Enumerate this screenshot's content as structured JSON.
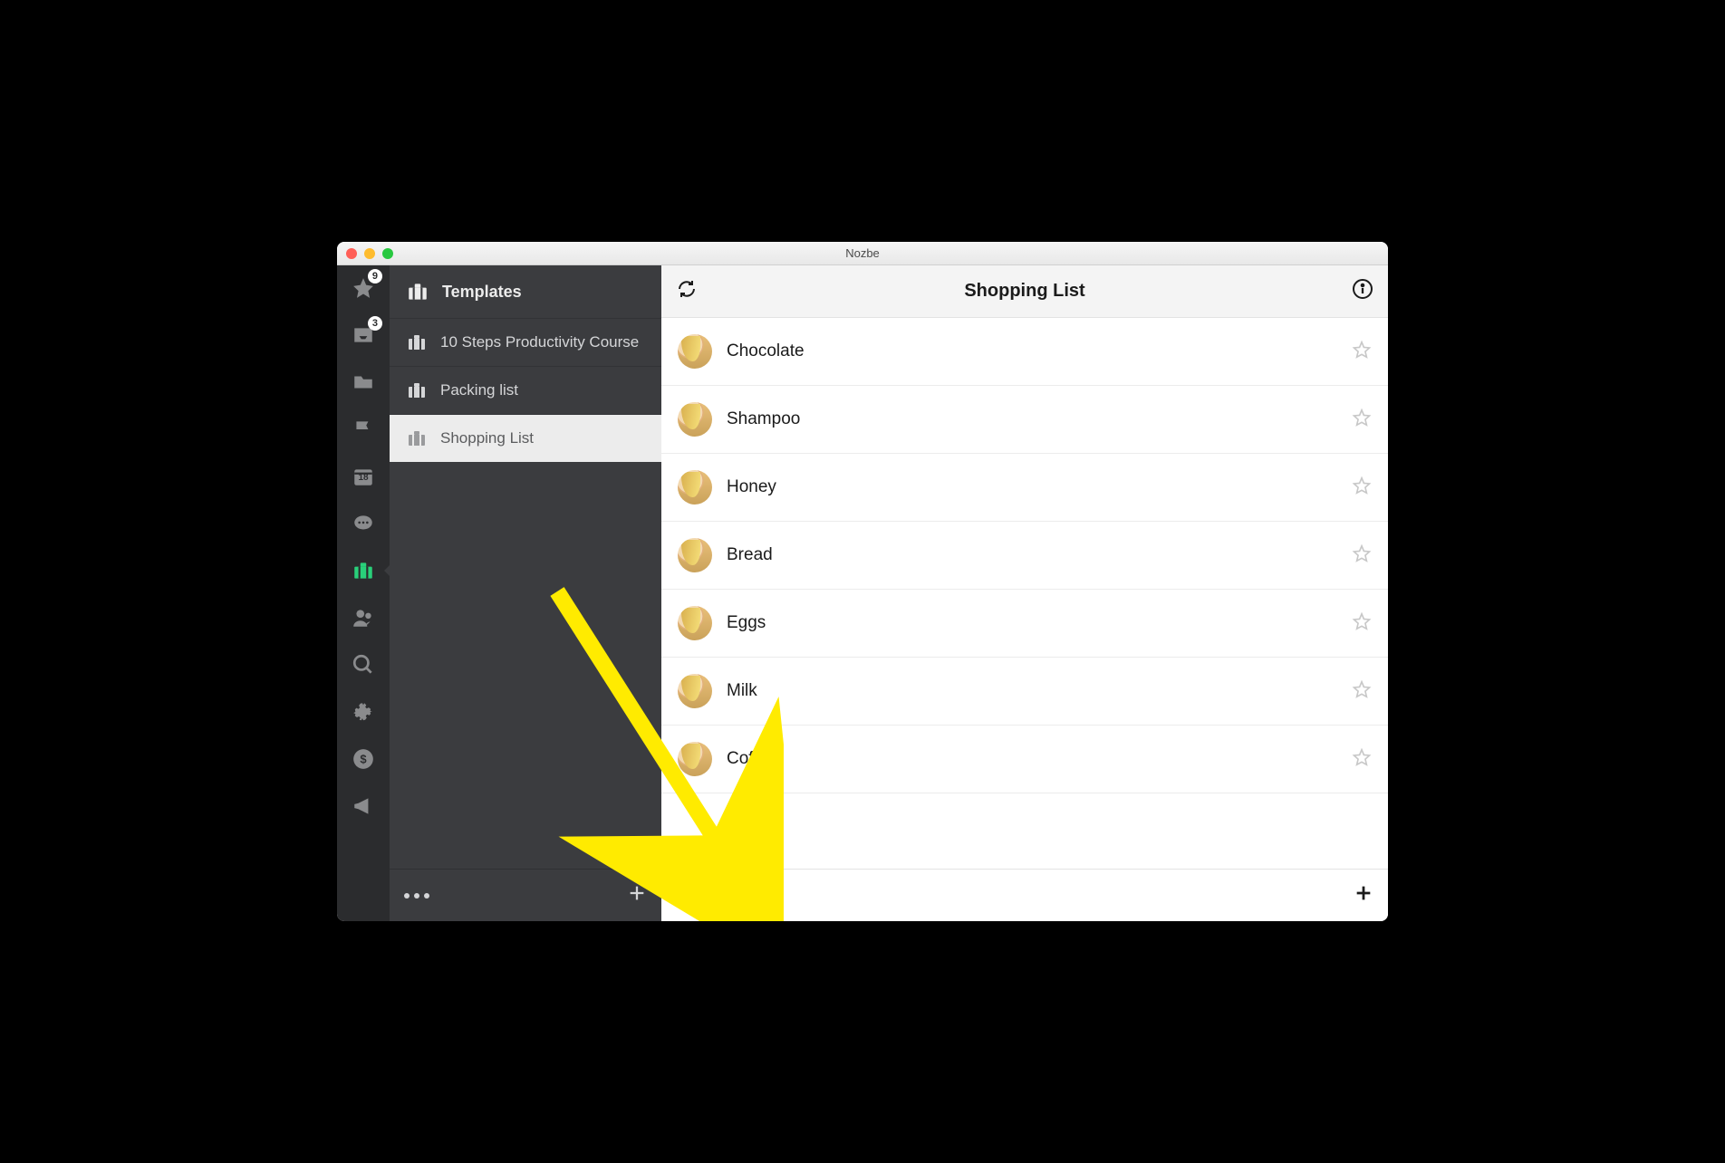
{
  "window": {
    "title": "Nozbe"
  },
  "rail": {
    "items": [
      {
        "id": "priority",
        "badge": "9"
      },
      {
        "id": "inbox",
        "badge": "3"
      },
      {
        "id": "projects"
      },
      {
        "id": "flag"
      },
      {
        "id": "calendar",
        "number": "18"
      },
      {
        "id": "comments"
      },
      {
        "id": "templates",
        "active": true
      },
      {
        "id": "team"
      },
      {
        "id": "search"
      },
      {
        "id": "settings"
      },
      {
        "id": "account"
      },
      {
        "id": "announce"
      }
    ]
  },
  "templates": {
    "header": "Templates",
    "items": [
      {
        "label": "10 Steps Productivity Course"
      },
      {
        "label": "Packing list"
      },
      {
        "label": "Shopping List",
        "selected": true
      }
    ]
  },
  "tasks": {
    "title": "Shopping List",
    "items": [
      {
        "name": "Chocolate"
      },
      {
        "name": "Shampoo"
      },
      {
        "name": "Honey"
      },
      {
        "name": "Bread"
      },
      {
        "name": "Eggs"
      },
      {
        "name": "Milk"
      },
      {
        "name": "Coffee"
      }
    ]
  }
}
